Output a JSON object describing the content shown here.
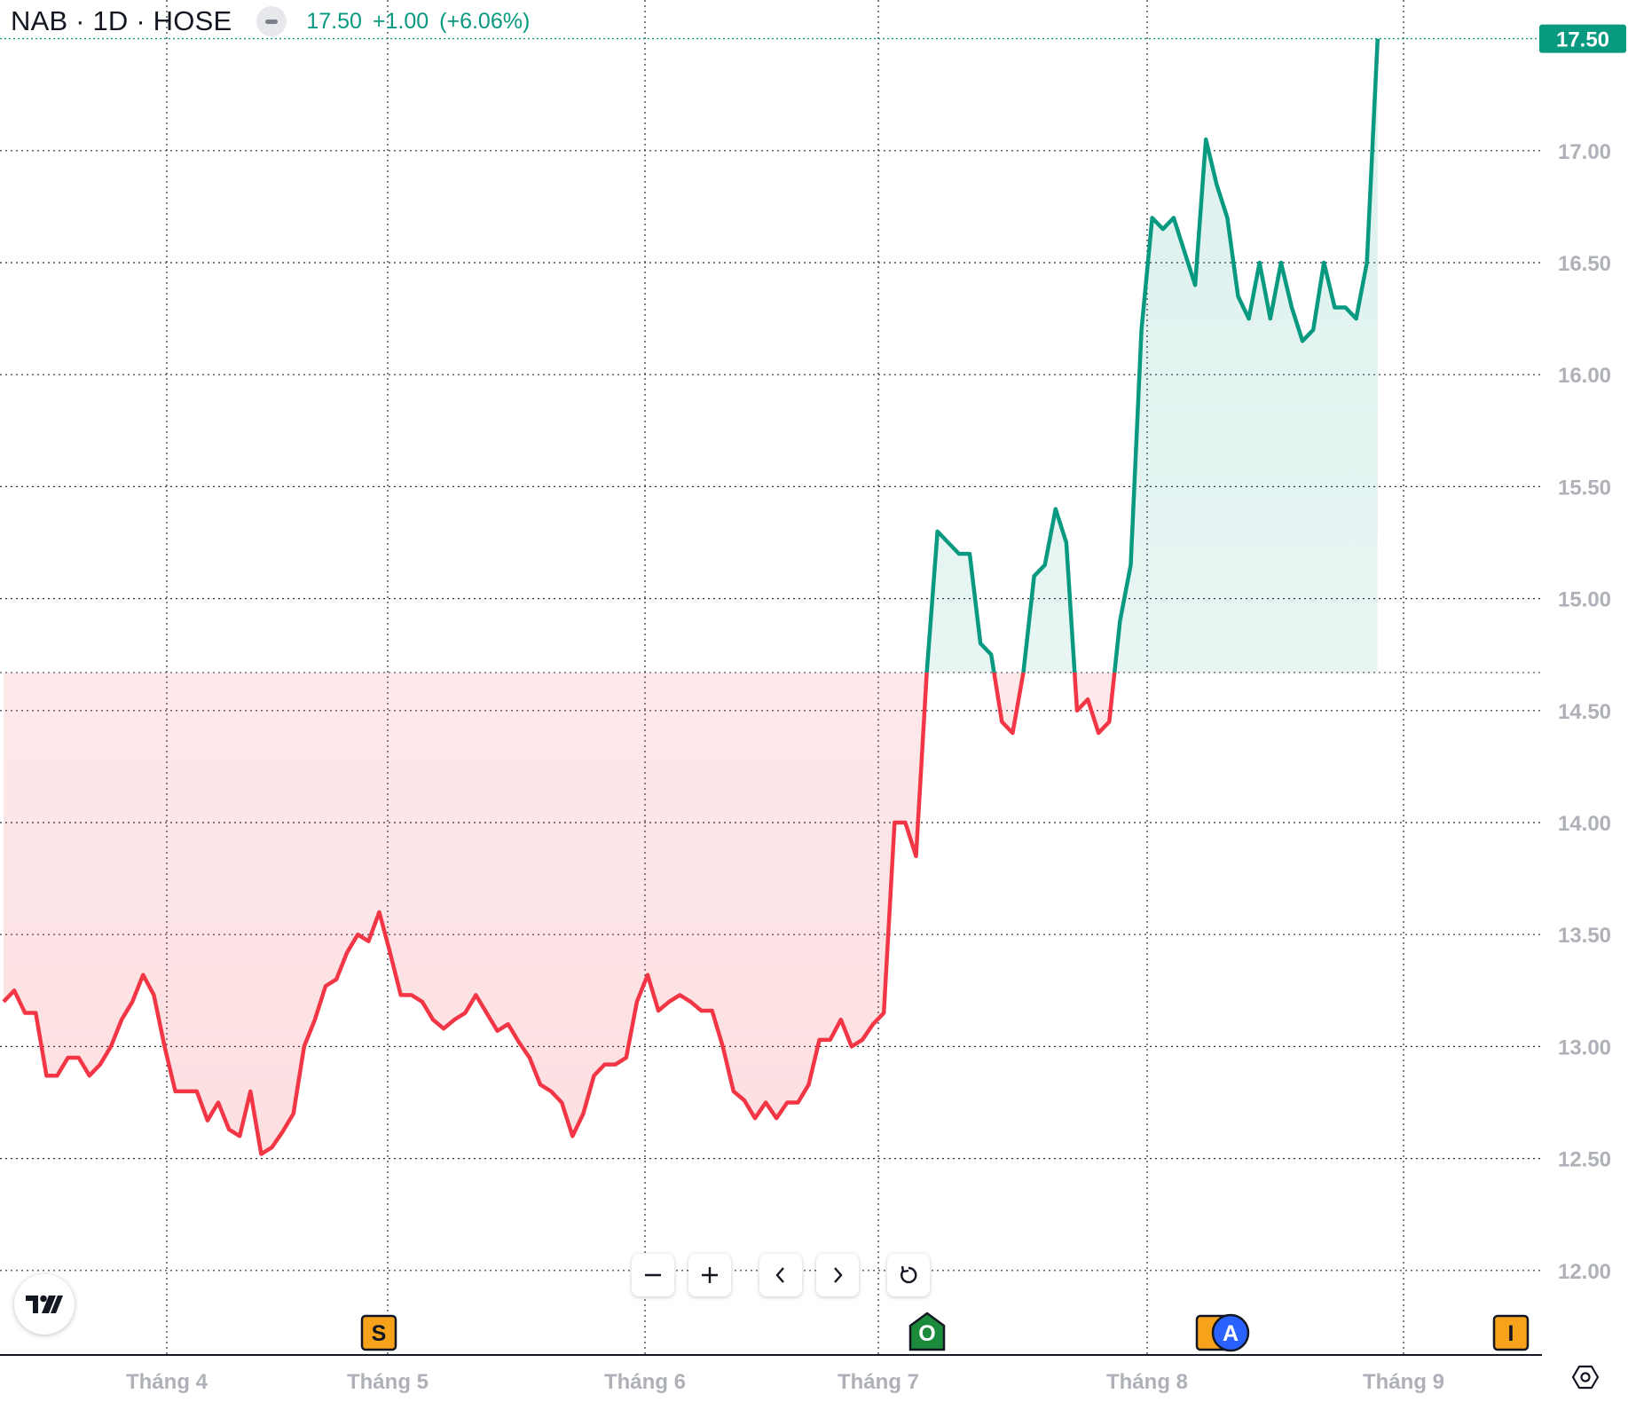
{
  "header": {
    "symbol_text": "NAB · 1D · HOSE",
    "price": "17.50",
    "change": "+1.00",
    "change_pct": "(+6.06%)"
  },
  "colors": {
    "up": "#089981",
    "down": "#f23645",
    "up_fill": "#e8f5f2",
    "down_fill": "#fde9eb",
    "grid": "#2a2e39",
    "axis_text": "#aeb1b8",
    "price_label_bg": "#089981"
  },
  "toolbar": {
    "zoom_out_icon": "minus-icon",
    "zoom_in_icon": "plus-icon",
    "scroll_left_icon": "chevron-left-icon",
    "scroll_right_icon": "chevron-right-icon",
    "reset_icon": "reset-icon"
  },
  "markers": [
    {
      "letter": "S",
      "style": "square",
      "fill": "#f7a21b",
      "text": "#131722"
    },
    {
      "letter": "O",
      "style": "house",
      "fill": "#1b8a3a",
      "text": "#ffffff"
    },
    {
      "letter": "",
      "style": "square",
      "fill": "#f7a21b",
      "text": "#131722"
    },
    {
      "letter": "A",
      "style": "circle",
      "fill": "#2962ff",
      "text": "#ffffff"
    },
    {
      "letter": "I",
      "style": "square",
      "fill": "#f7a21b",
      "text": "#131722"
    }
  ],
  "chart_data": {
    "type": "area",
    "title": "NAB · 1D · HOSE",
    "baseline": 14.67,
    "ylim": [
      11.85,
      17.85
    ],
    "y_ticks": [
      "12.00",
      "12.50",
      "13.00",
      "13.50",
      "14.00",
      "14.50",
      "15.00",
      "15.50",
      "16.00",
      "16.50",
      "17.00"
    ],
    "x_ticks": [
      "Tháng 4",
      "Tháng 5",
      "Tháng 6",
      "Tháng 7",
      "Tháng 8",
      "Tháng 9"
    ],
    "last_price_label": "17.50",
    "grid": true,
    "series": [
      {
        "values": [
          13.2,
          13.25,
          13.15,
          13.15,
          12.87,
          12.87,
          12.95,
          12.95,
          12.87,
          12.92,
          13.0,
          13.12,
          13.2,
          13.32,
          13.23,
          13.0,
          12.8,
          12.8,
          12.8,
          12.67,
          12.75,
          12.63,
          12.6,
          12.8,
          12.52,
          12.55,
          12.62,
          12.7,
          13.0,
          13.12,
          13.27,
          13.3,
          13.42,
          13.5,
          13.47,
          13.6,
          13.42,
          13.23,
          13.23,
          13.2,
          13.12,
          13.08,
          13.12,
          13.15,
          13.23,
          13.15,
          13.07,
          13.1,
          13.02,
          12.95,
          12.83,
          12.8,
          12.75,
          12.6,
          12.7,
          12.87,
          12.92,
          12.92,
          12.95,
          13.2,
          13.32,
          13.16,
          13.2,
          13.23,
          13.2,
          13.16,
          13.16,
          13.0,
          12.8,
          12.76,
          12.68,
          12.75,
          12.68,
          12.75,
          12.75,
          12.83,
          13.03,
          13.03,
          13.12,
          13.0,
          13.03,
          13.1,
          13.15,
          14.0,
          14.0,
          13.85,
          14.67,
          15.3,
          15.25,
          15.2,
          15.2,
          14.8,
          14.75,
          14.45,
          14.4,
          14.67,
          15.1,
          15.15,
          15.4,
          15.25,
          14.5,
          14.55,
          14.4,
          14.45,
          14.9,
          15.15,
          16.2,
          16.7,
          16.65,
          16.7,
          16.55,
          16.4,
          17.05,
          16.85,
          16.7,
          16.35,
          16.25,
          16.5,
          16.25,
          16.5,
          16.3,
          16.15,
          16.2,
          16.5,
          16.3,
          16.3,
          16.25,
          16.5,
          17.5
        ]
      }
    ]
  }
}
